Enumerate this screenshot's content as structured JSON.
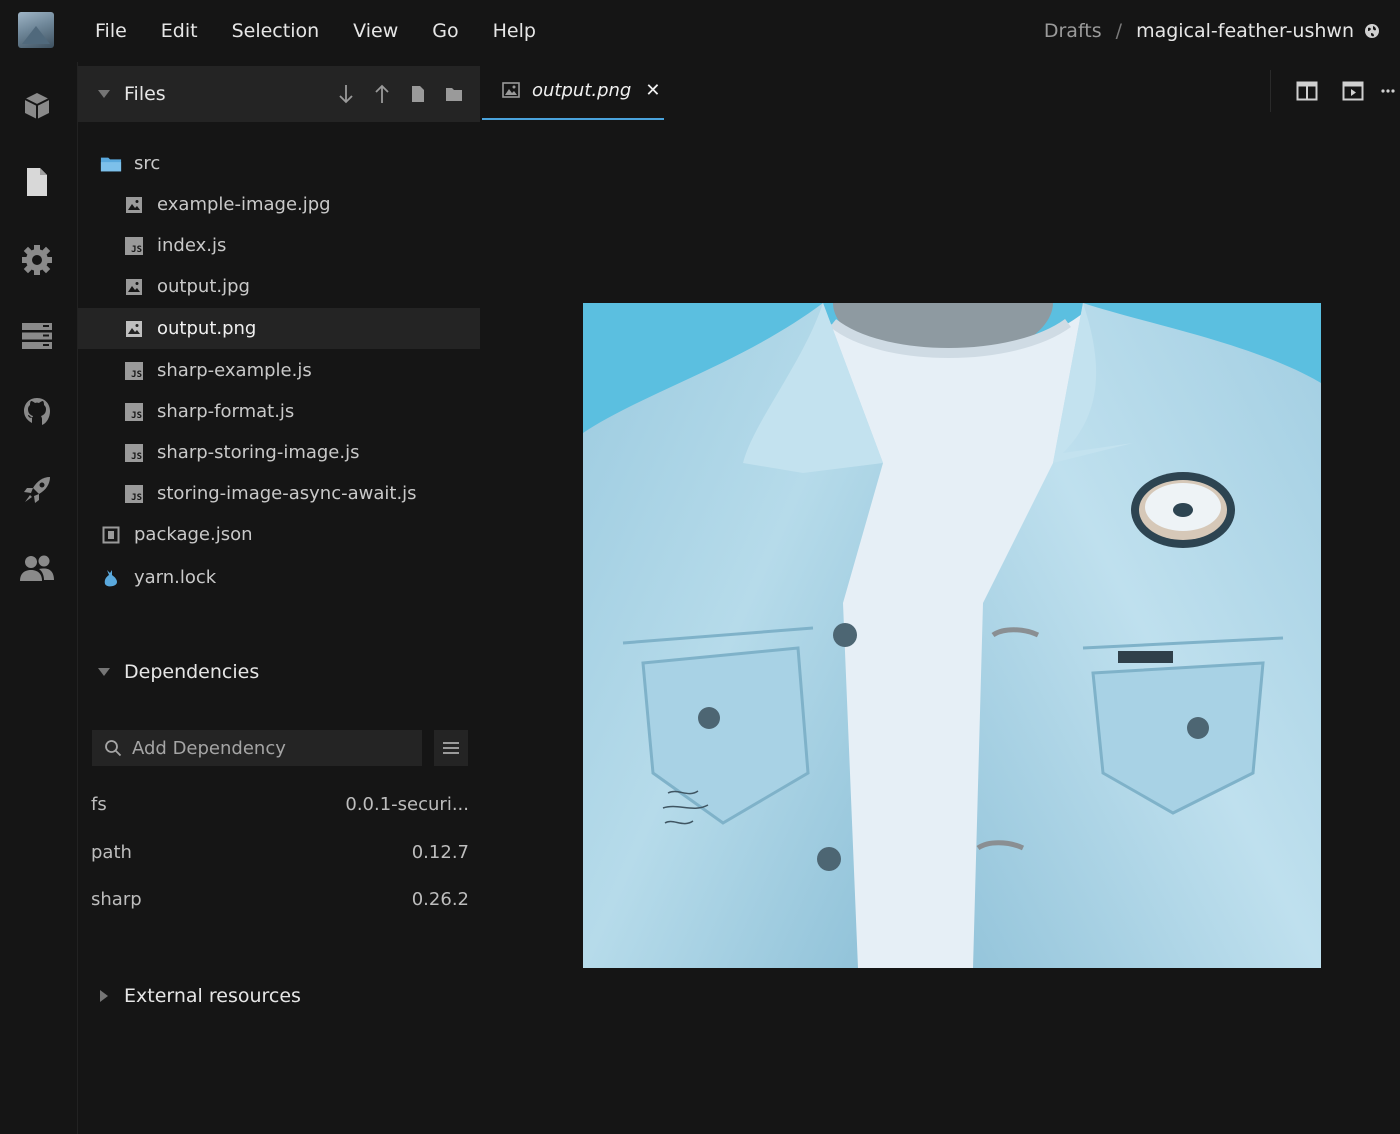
{
  "menu": {
    "items": [
      "File",
      "Edit",
      "Selection",
      "View",
      "Go",
      "Help"
    ]
  },
  "breadcrumb": {
    "folder": "Drafts",
    "separator": "/",
    "sandbox_name": "magical-feather-ushwn"
  },
  "activity_bar": {
    "icons": [
      "cube-icon",
      "file-icon",
      "gear-icon",
      "server-icon",
      "github-icon",
      "rocket-icon",
      "users-icon"
    ]
  },
  "files": {
    "title": "Files",
    "tree": [
      {
        "name": "src",
        "type": "folder",
        "level": 0
      },
      {
        "name": "example-image.jpg",
        "type": "image",
        "level": 1
      },
      {
        "name": "index.js",
        "type": "js",
        "level": 1
      },
      {
        "name": "output.jpg",
        "type": "image",
        "level": 1
      },
      {
        "name": "output.png",
        "type": "image",
        "level": 1,
        "active": true
      },
      {
        "name": "sharp-example.js",
        "type": "js",
        "level": 1
      },
      {
        "name": "sharp-format.js",
        "type": "js",
        "level": 1
      },
      {
        "name": "sharp-storing-image.js",
        "type": "js",
        "level": 1
      },
      {
        "name": "storing-image-async-await.js",
        "type": "js",
        "level": 1
      },
      {
        "name": "package.json",
        "type": "json",
        "level": 0
      },
      {
        "name": "yarn.lock",
        "type": "yarn",
        "level": 0
      }
    ]
  },
  "dependencies": {
    "title": "Dependencies",
    "search_placeholder": "Add Dependency",
    "items": [
      {
        "name": "fs",
        "version": "0.0.1-securi..."
      },
      {
        "name": "path",
        "version": "0.12.7"
      },
      {
        "name": "sharp",
        "version": "0.26.2"
      }
    ]
  },
  "external": {
    "title": "External resources"
  },
  "editor": {
    "tab_label": "output.png",
    "tab_close": "✕"
  },
  "colors": {
    "background": "#151515",
    "panel": "#242424",
    "accent": "#4aa3dc",
    "folder": "#5aa9dd",
    "sky": "#5bbfe0",
    "denim": "#a9d2e4"
  }
}
